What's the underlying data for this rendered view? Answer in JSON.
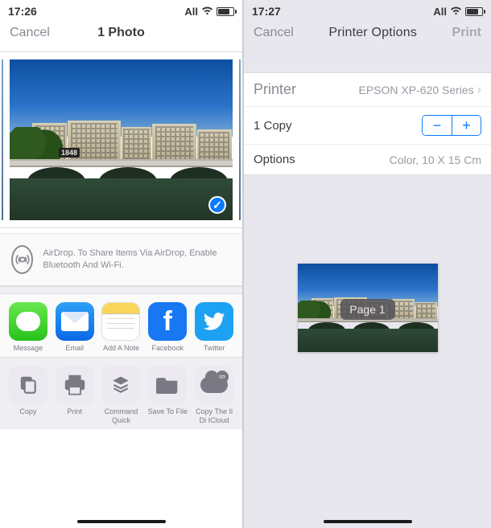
{
  "left": {
    "status": {
      "time": "17:26",
      "carrier": "All"
    },
    "nav": {
      "cancel": "Cancel",
      "title": "1 Photo"
    },
    "photo": {
      "date": "1848"
    },
    "airdrop": {
      "title": "AirDrop.",
      "desc": "To Share Items Via AirDrop, Enable Bluetooth And Wi-Fi."
    },
    "share": [
      {
        "name": "messages",
        "label": "Message"
      },
      {
        "name": "email",
        "label": "Email"
      },
      {
        "name": "notes",
        "label": "Add A Note"
      },
      {
        "name": "facebook",
        "label": "Facebook"
      },
      {
        "name": "twitter",
        "label": "Twitter"
      }
    ],
    "actions": [
      {
        "name": "copy",
        "label": "Copy"
      },
      {
        "name": "print",
        "label": "Print"
      },
      {
        "name": "command-quick",
        "label": "Command Quick"
      },
      {
        "name": "save-to-file",
        "label": "Save To File"
      },
      {
        "name": "copy-icloud",
        "label": "Copy The Il Di ICloud"
      }
    ]
  },
  "right": {
    "status": {
      "time": "17:27",
      "carrier": "All"
    },
    "nav": {
      "cancel": "Cancel",
      "title": "Printer Options",
      "print": "Print"
    },
    "rows": {
      "printer_key": "Printer",
      "printer_val": "EPSON XP-620 Series",
      "copies_key": "1 Copy",
      "options_key": "Options",
      "options_val": "Color, 10 X 15 Cm"
    },
    "preview": {
      "page_label": "Page 1"
    }
  }
}
